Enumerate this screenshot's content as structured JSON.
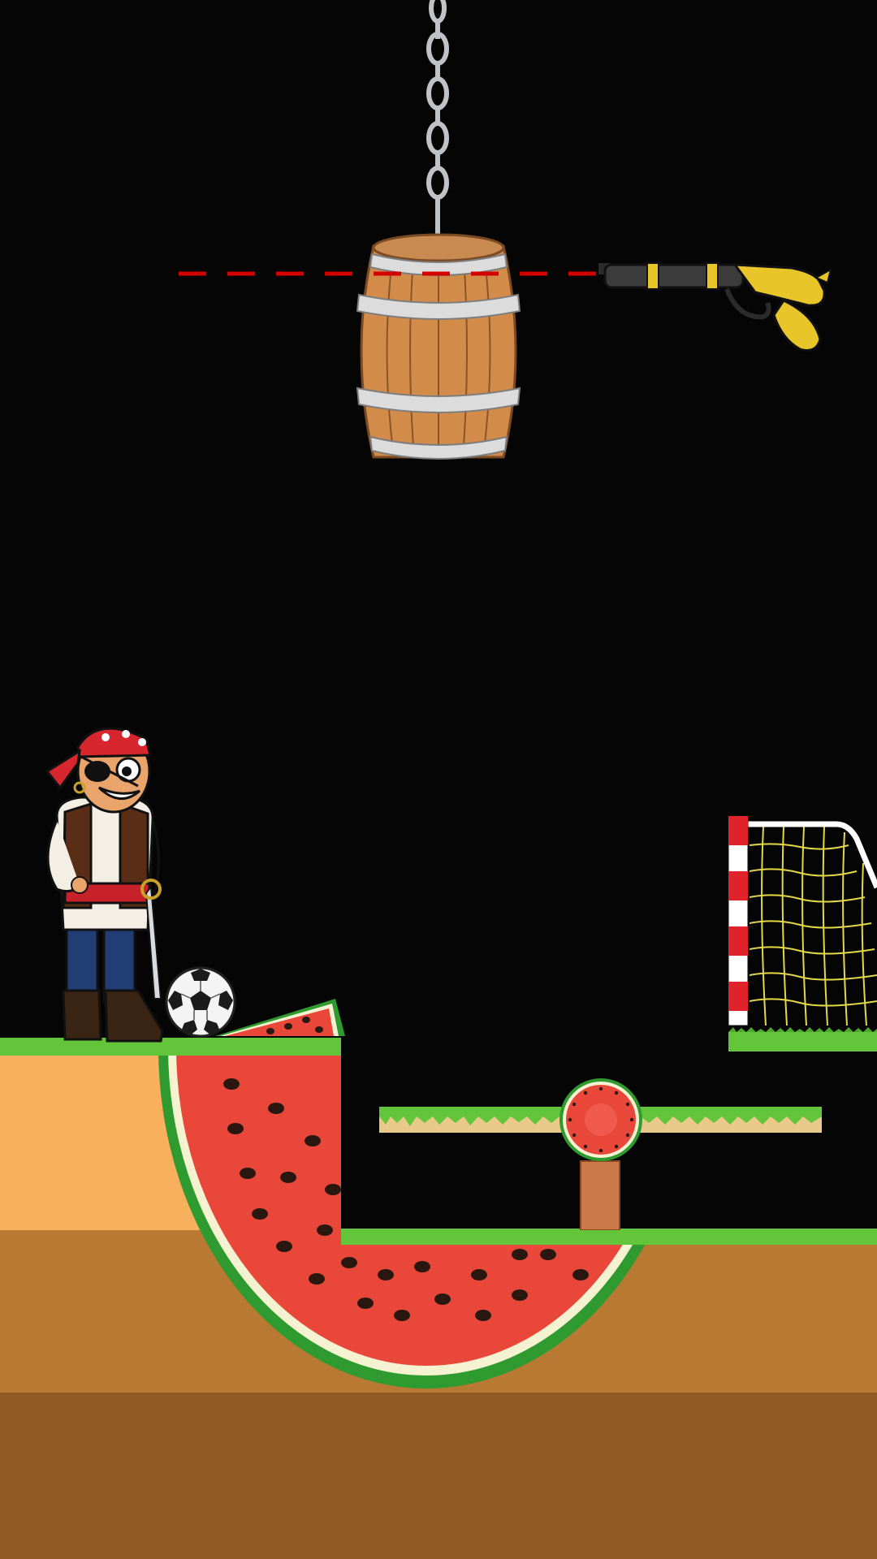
{
  "scene": {
    "background_color": "#050505",
    "objects": [
      "chain",
      "barrel",
      "flintlock-pistol",
      "aim-line",
      "pirate",
      "soccer-ball",
      "soccer-goal",
      "watermelon",
      "seesaw",
      "watermelon-slice-wheel",
      "grass-ground",
      "dirt-ground"
    ]
  },
  "colors": {
    "grass": "#63c53a",
    "sand": "#f8b05c",
    "dirt": "#b87a33",
    "deep_dirt": "#8f5a23",
    "aim_line": "#d40000",
    "goal_post_red": "#e0222b",
    "goal_net": "#e3d84a",
    "melon_red": "#e9473a",
    "melon_rind": "#2f9a2f",
    "barrel_wood": "#d38b4a",
    "pistol_gold": "#e8c62a"
  },
  "icons": {
    "pirate_bandana": "skull-and-crossbones-icon",
    "ball": "soccer-ball-icon"
  }
}
